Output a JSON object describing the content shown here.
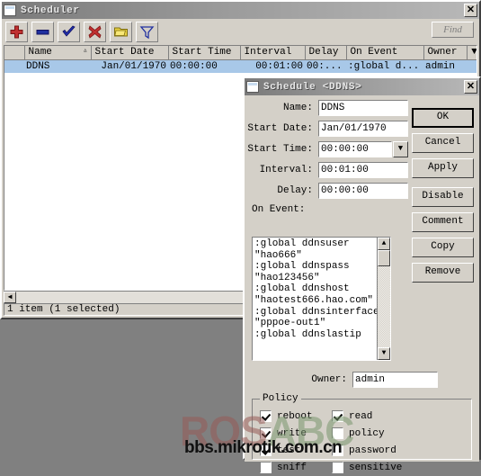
{
  "desktop": {
    "background": "#808080"
  },
  "scheduler_window": {
    "title": "Scheduler",
    "close_label": "✕",
    "toolbar": {
      "buttons": [
        {
          "name": "add-button",
          "icon": "plus-icon"
        },
        {
          "name": "remove-button",
          "icon": "minus-icon"
        },
        {
          "name": "enable-button",
          "icon": "check-icon"
        },
        {
          "name": "disable-button",
          "icon": "cross-icon"
        },
        {
          "name": "comment-button",
          "icon": "folder-icon"
        },
        {
          "name": "filter-button",
          "icon": "funnel-icon"
        }
      ],
      "find_label": "Find"
    },
    "table": {
      "columns": [
        "",
        "Name",
        "Start Date",
        "Start Time",
        "Interval",
        "Delay",
        "On Event",
        "Owner",
        "▼"
      ],
      "sorted_column": "Name",
      "rows": [
        {
          "flag": "",
          "name": "DDNS",
          "start_date": "Jan/01/1970",
          "start_time": "00:00:00",
          "interval": "00:01:00",
          "delay": "00:...",
          "on_event": ":global d...",
          "owner": "admin",
          "selected": true
        }
      ]
    },
    "statusbar": "1 item (1 selected)"
  },
  "schedule_dialog": {
    "title": "Schedule <DDNS>",
    "close_label": "✕",
    "fields": {
      "name_label": "Name:",
      "name_value": "DDNS",
      "start_date_label": "Start Date:",
      "start_date_value": "Jan/01/1970",
      "start_time_label": "Start Time:",
      "start_time_value": "00:00:00",
      "interval_label": "Interval:",
      "interval_value": "00:01:00",
      "delay_label": "Delay:",
      "delay_value": "00:00:00",
      "on_event_label": "On Event:",
      "on_event_value": ":global ddnsuser\n\"hao666\"\n:global ddnspass\n\"hao123456\"\n:global ddnshost\n\"haotest666.hao.com\"\n:global ddnsinterface\n\"pppoe-out1\"\n:global ddnslastip",
      "owner_label": "Owner:",
      "owner_value": "admin"
    },
    "buttons": [
      {
        "label": "OK",
        "name": "ok-button",
        "default": true
      },
      {
        "label": "Cancel",
        "name": "cancel-button",
        "default": false
      },
      {
        "label": "Apply",
        "name": "apply-button",
        "default": false
      },
      {
        "label": "Disable",
        "name": "disable-button",
        "default": false
      },
      {
        "label": "Comment",
        "name": "comment-button",
        "default": false
      },
      {
        "label": "Copy",
        "name": "copy-button",
        "default": false
      },
      {
        "label": "Remove",
        "name": "remove-button",
        "default": false
      }
    ],
    "policy": {
      "legend": "Policy",
      "items": [
        {
          "label": "reboot",
          "checked": true
        },
        {
          "label": "read",
          "checked": true
        },
        {
          "label": "write",
          "checked": true
        },
        {
          "label": "policy",
          "checked": false
        },
        {
          "label": "test",
          "checked": true
        },
        {
          "label": "password",
          "checked": false
        },
        {
          "label": "sniff",
          "checked": false
        },
        {
          "label": "sensitive",
          "checked": false
        }
      ]
    }
  },
  "watermark": {
    "brand_part1": "ROS",
    "brand_part2": "ABC",
    "url": "bbs.mikrotik.com.cn",
    "brand_color1": "#965a55",
    "brand_color2": "#78966e"
  }
}
